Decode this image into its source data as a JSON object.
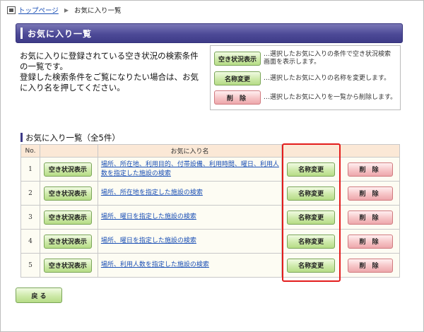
{
  "breadcrumb": {
    "home": "トップページ",
    "current": "お気に入り一覧"
  },
  "page_title": "お気に入り一覧",
  "intro": {
    "line1": "お気に入りに登録されている空き状況の検索条件の一覧です。",
    "line2": "登録した検索条件をご覧になりたい場合は、お気に入り名を押してください。"
  },
  "legend": [
    {
      "button": "空き状況表示",
      "description": "…選択したお気に入りの条件で空き状況検索画面を表示します。"
    },
    {
      "button": "名称変更",
      "description": "…選択したお気に入りの名称を変更します。"
    },
    {
      "button": "削 除",
      "description": "…選択したお気に入りを一覧から削除します。"
    }
  ],
  "section_title": "お気に入り一覧（全5件）",
  "table": {
    "headers": {
      "no": "No.",
      "name": "お気に入り名"
    },
    "rows": [
      {
        "no": "1",
        "name": "場所、所在地、利用目的、付帯設備、利用時間、曜日、利用人数を指定した施設の検索"
      },
      {
        "no": "2",
        "name": "場所、所在地を指定した施設の検索"
      },
      {
        "no": "3",
        "name": "場所、曜日を指定した施設の検索"
      },
      {
        "no": "4",
        "name": "場所、曜日を指定した施設の検索"
      },
      {
        "no": "5",
        "name": "場所、利用人数を指定した施設の検索"
      }
    ],
    "button_status": "空き状況表示",
    "button_rename": "名称変更",
    "button_delete": "削 除"
  },
  "back_button": "戻 る",
  "colors": {
    "title_bar": "#4d4a97",
    "highlight": "#e31c1c",
    "header_bg": "#fbe8d6"
  }
}
